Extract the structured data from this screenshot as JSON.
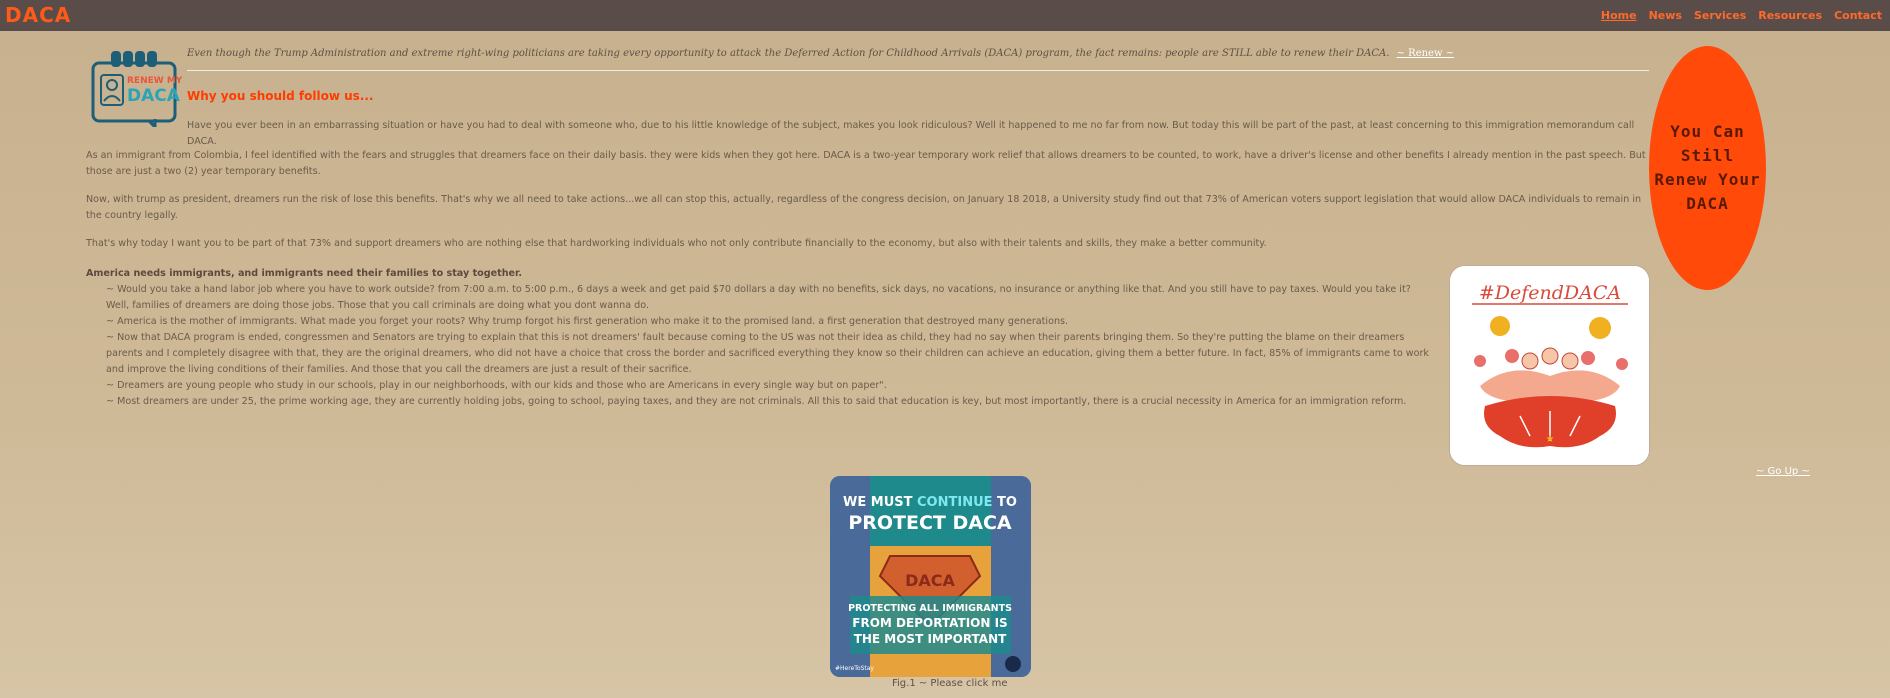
{
  "nav": {
    "brand": "DACA",
    "items": [
      {
        "label": "Home"
      },
      {
        "label": "News"
      },
      {
        "label": "Services"
      },
      {
        "label": "Resources"
      },
      {
        "label": "Contact"
      }
    ]
  },
  "logo": {
    "line1": "RENEW MY",
    "line2": "DACA"
  },
  "intro": {
    "text": "Even though the Trump Administration and extreme right-wing politicians are taking every opportunity to attack the Deferred Action for Childhood Arrivals (DACA) program, the fact remains: people are STILL able to renew their DACA.",
    "renew_link": "~ Renew ~"
  },
  "why_heading": "Why you should follow us...",
  "paragraphs": [
    "Have you ever been in an embarrassing situation or have you had to deal with someone who, due to his little knowledge of the subject, makes you look ridiculous? Well it happened to me no far from now. But today this will be part of the past, at least concerning to this immigration memorandum call DACA.",
    "As an immigrant from Colombia, I feel identified with the fears and struggles that dreamers face on their daily basis. they were kids when they got here. DACA is a two-year temporary work relief that allows dreamers to be counted, to work, have a driver's license and other benefits I already mention in the past speech. But those are just a two (2) year temporary benefits.",
    "Now, with trump as president, dreamers run the risk of lose this benefits. That's why we all need to take actions...we all can stop this, actually, regardless of the congress decision, on January 18 2018, a University study find out that 73% of American voters support legislation that would allow DACA individuals to remain in the country legally.",
    "That's why today I want you to be part of that 73% and support dreamers who are nothing else that hardworking individuals who not only contribute financially to the economy, but also with their talents and skills, they make a better community.",
    "America needs immigrants, and immigrants need their families to stay together."
  ],
  "list": [
    "~ Would you take a hand labor job where you have to work outside? from 7:00 a.m. to 5:00 p.m., 6 days a week and get paid $70 dollars a day with no benefits, sick days, no vacations, no insurance or anything like that. And you still have to pay taxes. Would you take it? Well, families of dreamers are doing those jobs. Those that you call criminals are doing what you dont wanna do.",
    "~ America is the mother of immigrants. What made you forget your roots? Why trump forgot his first generation who make it to the promised land. a first generation that destroyed many generations.",
    "~ Now that DACA program is ended, congressmen and Senators are trying to explain that this is not dreamers' fault because coming to the US was not their idea as child, they had no say when their parents bringing them. So they're putting the blame on their dreamers parents and I completely disagree with that, they are the original dreamers, who did not have a choice that cross the border and sacrificed everything they know so their children can achieve an education, giving them a better future. In fact, 85% of immigrants came to work and improve the living conditions of their families. And those that you call the dreamers are just a result of their sacrifice.",
    "~ Dreamers are young people who study in our schools, play in our neighborhoods, with our kids and those who are Americans in every single way but on paper\".",
    "~ Most dreamers are under 25, the prime working age, they are currently holding jobs, going to school, paying taxes, and they are not criminals. All this to said that education is key, but most importantly, there is a crucial necessity in America for an immigration reform."
  ],
  "oval": {
    "line1": "You Can Still",
    "line2": "Renew Your",
    "line3": "DACA"
  },
  "defend_image": {
    "text": "#DefendDACA"
  },
  "go_up": "~ Go Up ~",
  "poster": {
    "line1a": "WE MUST ",
    "line1b": "CONTINUE",
    "line1c": " TO",
    "line2": "PROTECT DACA",
    "shield": "DACA",
    "line3": "PROTECTING ALL IMMIGRANTS",
    "line4": "FROM DEPORTATION IS",
    "line5": "THE MOST IMPORTANT",
    "tag": "#HereToStay"
  },
  "caption": "Fig.1 ~ Please click me",
  "colors": {
    "accent": "#ff4a0a",
    "nav_bg": "#5a4d49",
    "bg": "#cbb491"
  }
}
